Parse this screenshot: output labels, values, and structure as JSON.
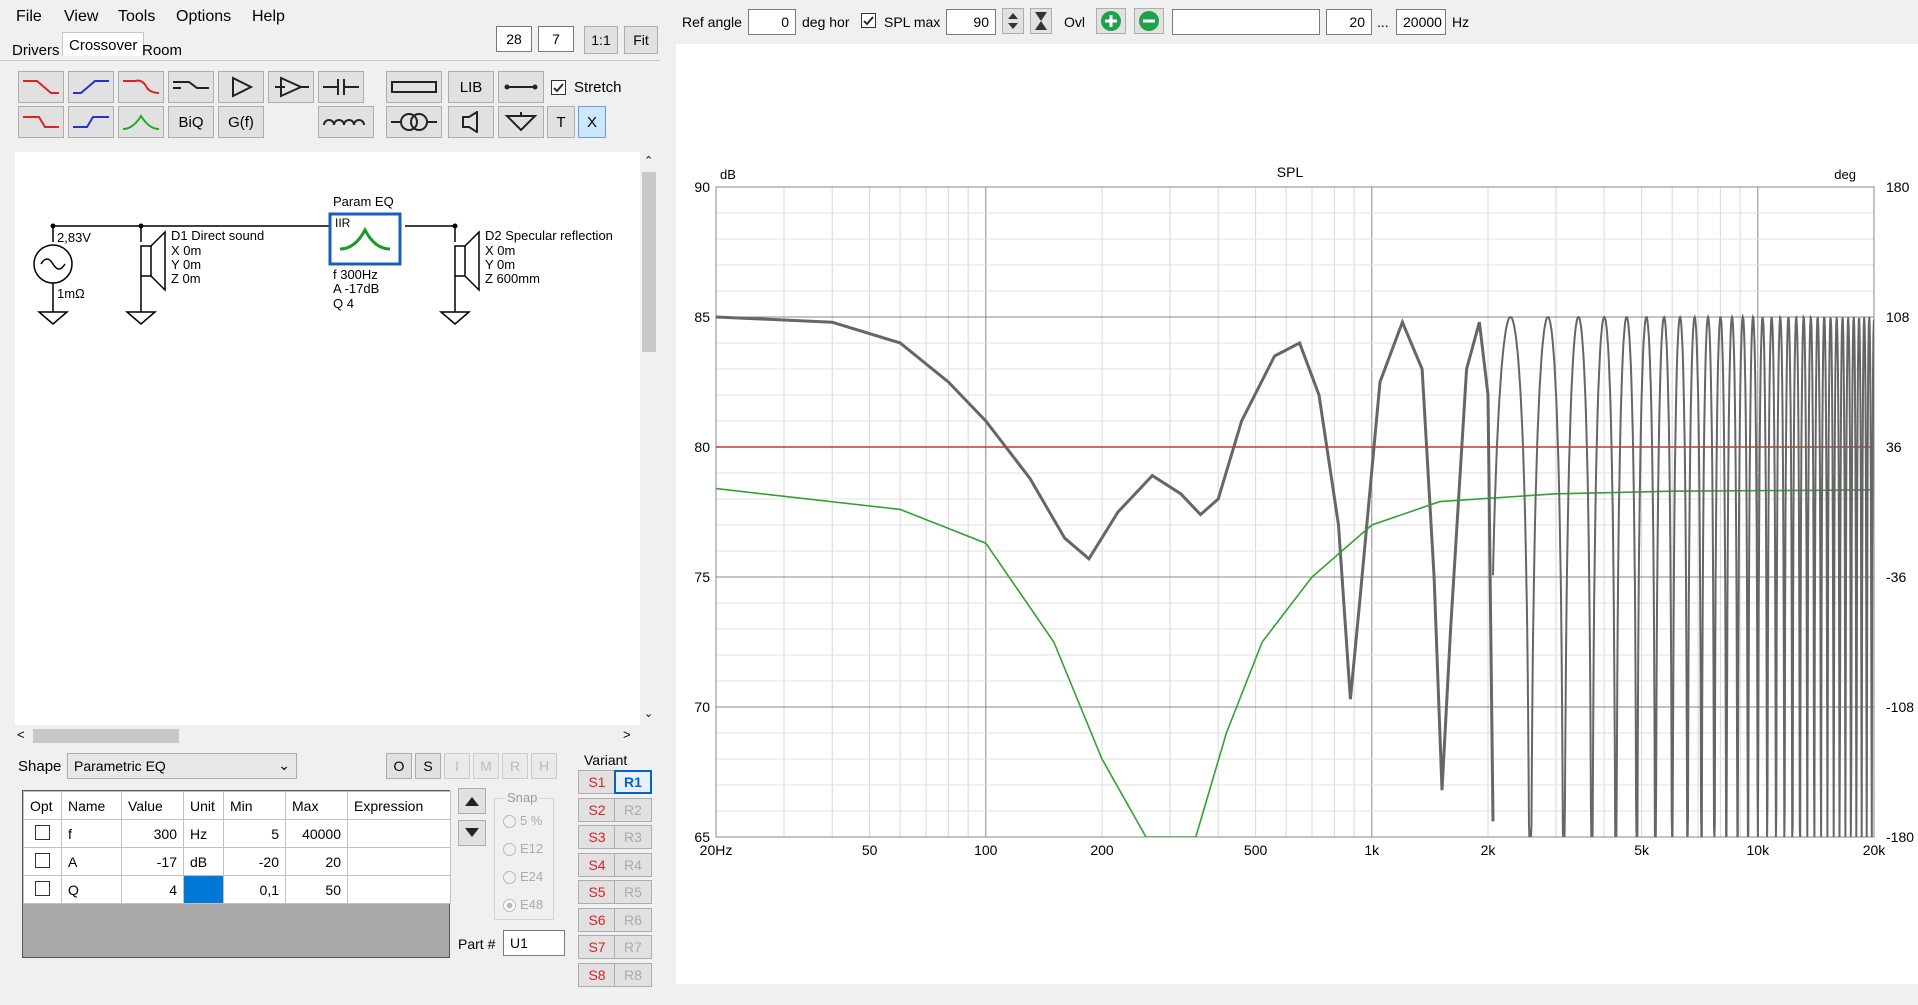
{
  "menu": [
    "File",
    "View",
    "Tools",
    "Options",
    "Help"
  ],
  "tabs": [
    "Drivers",
    "Crossover",
    "Room"
  ],
  "zoom": {
    "a": "28",
    "b": "7",
    "one": "1:1",
    "fit": "Fit"
  },
  "toolbar": {
    "lib": "LIB",
    "biq": "BiQ",
    "gf": "G(f)",
    "t": "T",
    "x": "X",
    "stretch": "Stretch"
  },
  "schematic": {
    "source_v": "2,83V",
    "source_r": "1mΩ",
    "d1": {
      "name": "D1 Direct sound",
      "x": "X 0m",
      "y": "Y 0m",
      "z": "Z 0m"
    },
    "eq": {
      "title": "Param EQ",
      "type": "IIR",
      "f": "f  300Hz",
      "a": "A  -17dB",
      "q": "Q  4"
    },
    "d2": {
      "name": "D2 Specular reflection",
      "x": "X 0m",
      "y": "Y 0m",
      "z": "Z 600mm"
    }
  },
  "shape": {
    "label": "Shape",
    "value": "Parametric EQ"
  },
  "flags": [
    "O",
    "S",
    "I",
    "M",
    "R",
    "H"
  ],
  "params": {
    "headers": [
      "Opt",
      "Name",
      "Value",
      "Unit",
      "Min",
      "Max",
      "Expression"
    ],
    "rows": [
      {
        "name": "f",
        "value": "300",
        "unit": "Hz",
        "min": "5",
        "max": "40000",
        "expr": ""
      },
      {
        "name": "A",
        "value": "-17",
        "unit": "dB",
        "min": "-20",
        "max": "20",
        "expr": ""
      },
      {
        "name": "Q",
        "value": "4",
        "unit": "",
        "min": "0,1",
        "max": "50",
        "expr": ""
      }
    ]
  },
  "snap": {
    "title": "Snap",
    "options": [
      "5 %",
      "E12",
      "E24",
      "E48"
    ]
  },
  "part": {
    "label": "Part #",
    "value": "U1"
  },
  "variant": {
    "title": "Variant",
    "s": [
      "S1",
      "S2",
      "S3",
      "S4",
      "S5",
      "S6",
      "S7",
      "S8"
    ],
    "r": [
      "R1",
      "R2",
      "R3",
      "R4",
      "R5",
      "R6",
      "R7",
      "R8"
    ]
  },
  "topbar": {
    "ref_angle_label": "Ref angle",
    "ref_angle": "0",
    "deg_hor": "deg hor",
    "spl_max_label": "SPL max",
    "spl_max": "90",
    "ovl": "Ovl",
    "fmin": "20",
    "dots": "...",
    "fmax": "20000",
    "hz": "Hz"
  },
  "chart_data": {
    "type": "line",
    "title": "SPL",
    "ylabel_left": "dB",
    "ylabel_right": "deg",
    "xscale": "log",
    "xlim": [
      20,
      20000
    ],
    "ylim": [
      65,
      90
    ],
    "ylim_right": [
      -180,
      180
    ],
    "x_ticks": [
      "20Hz",
      "50",
      "100",
      "200",
      "500",
      "1k",
      "2k",
      "5k",
      "10k",
      "20k"
    ],
    "x_tick_values": [
      20,
      50,
      100,
      200,
      500,
      1000,
      2000,
      5000,
      10000,
      20000
    ],
    "y_ticks": [
      90,
      85,
      80,
      75,
      70,
      65
    ],
    "y_right_ticks": [
      "180",
      "108",
      "36",
      "-36",
      "-108",
      "-180"
    ],
    "grid": true,
    "series": [
      {
        "color": "#666666",
        "points": [
          [
            20,
            85
          ],
          [
            40,
            84.8
          ],
          [
            60,
            84
          ],
          [
            80,
            82.5
          ],
          [
            100,
            81
          ],
          [
            130,
            78.8
          ],
          [
            160,
            76.5
          ],
          [
            185,
            75.7
          ],
          [
            220,
            77.5
          ],
          [
            270,
            78.9
          ],
          [
            320,
            78.2
          ],
          [
            360,
            77.4
          ],
          [
            400,
            78
          ],
          [
            460,
            81
          ],
          [
            560,
            83.5
          ],
          [
            650,
            84
          ],
          [
            730,
            82
          ],
          [
            820,
            77
          ],
          [
            880,
            70.3
          ],
          [
            930,
            74
          ],
          [
            1050,
            82.5
          ],
          [
            1200,
            84.8
          ],
          [
            1350,
            83
          ],
          [
            1450,
            75
          ],
          [
            1520,
            66.8
          ],
          [
            1600,
            73
          ],
          [
            1760,
            83
          ],
          [
            1900,
            84.8
          ],
          [
            2000,
            82
          ],
          [
            2060,
            65.6
          ]
        ]
      },
      {
        "color": "#cc3333",
        "points": [
          [
            20,
            80
          ],
          [
            20000,
            80
          ]
        ]
      },
      {
        "color": "#33a033",
        "points": [
          [
            20,
            78.4
          ],
          [
            60,
            77.6
          ],
          [
            100,
            76.3
          ],
          [
            150,
            72.5
          ],
          [
            200,
            68
          ],
          [
            260,
            65
          ],
          [
            350,
            65
          ],
          [
            420,
            69
          ],
          [
            520,
            72.5
          ],
          [
            700,
            75
          ],
          [
            1000,
            77
          ],
          [
            1500,
            77.9
          ],
          [
            3000,
            78.2
          ],
          [
            6000,
            78.3
          ],
          [
            20000,
            78.35
          ]
        ]
      }
    ]
  },
  "colors": {
    "accent": "#0078d7",
    "selected": "#0063cc"
  }
}
